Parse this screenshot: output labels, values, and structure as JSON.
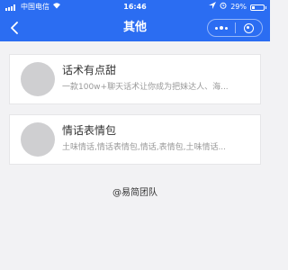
{
  "status_bar": {
    "carrier": "中国电信",
    "time": "16:46",
    "battery": "29%",
    "battery_level": 0.29
  },
  "nav": {
    "title": "其他"
  },
  "items": [
    {
      "title": "话术有点甜",
      "desc": "一款100w+聊天话术让你成为把妹达人、海..."
    },
    {
      "title": "情话表情包",
      "desc": "土味情话,情话表情包,情话,表情包,土味情话..."
    }
  ],
  "footer": {
    "text": "@易简团队"
  },
  "colors": {
    "header": "#2b6df2",
    "background": "#f2f2f4",
    "avatar": "#cfcfd1"
  }
}
